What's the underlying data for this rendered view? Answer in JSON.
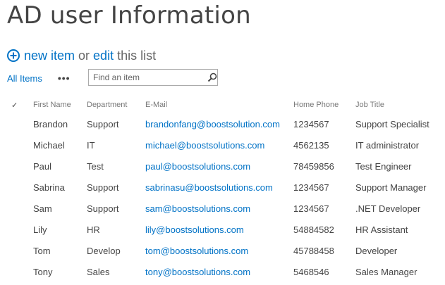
{
  "page": {
    "title": "AD user Information"
  },
  "actions": {
    "new_item": "new item",
    "or": "or",
    "edit": "edit",
    "this_list": "this list"
  },
  "toolbar": {
    "view": "All Items",
    "more": "•••",
    "search_placeholder": "Find an item"
  },
  "table": {
    "check_col": "✓",
    "headers": [
      "First Name",
      "Department",
      "E-Mail",
      "Home Phone",
      "Job Title"
    ],
    "rows": [
      [
        "Brandon",
        "Support",
        "brandonfang@boostsolution.com",
        "1234567",
        "Support Specialist"
      ],
      [
        "Michael",
        "IT",
        "michael@boostsolutions.com",
        "4562135",
        "IT administrator"
      ],
      [
        "Paul",
        "Test",
        "paul@boostsolutions.com",
        "78459856",
        "Test Engineer"
      ],
      [
        "Sabrina",
        "Support",
        "sabrinasu@boostsolutions.com",
        "1234567",
        "Support Manager"
      ],
      [
        "Sam",
        "Support",
        "sam@boostsolutions.com",
        "1234567",
        ".NET Developer"
      ],
      [
        "Lily",
        "HR",
        "lily@boostsolutions.com",
        "54884582",
        "HR Assistant"
      ],
      [
        "Tom",
        "Develop",
        "tom@boostsolutions.com",
        "45788458",
        "Developer"
      ],
      [
        "Tony",
        "Sales",
        "tony@boostsolutions.com",
        "5468546",
        "Sales Manager"
      ]
    ]
  },
  "colors": {
    "link": "#0072c6",
    "text": "#444444",
    "header_text": "#777777"
  }
}
